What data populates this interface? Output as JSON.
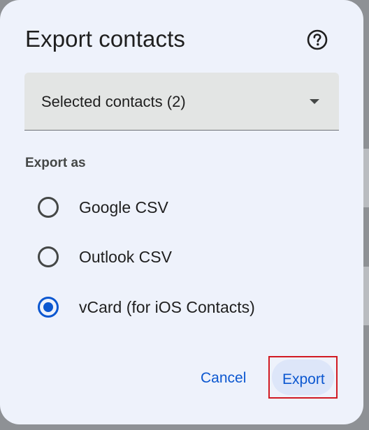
{
  "dialog": {
    "title": "Export contacts",
    "help_icon": "help-circle-icon"
  },
  "selector": {
    "value": "Selected contacts (2)",
    "caret_icon": "dropdown-caret-icon"
  },
  "export_as": {
    "label": "Export as",
    "options": [
      {
        "label": "Google CSV",
        "selected": false
      },
      {
        "label": "Outlook CSV",
        "selected": false
      },
      {
        "label": "vCard (for iOS Contacts)",
        "selected": true
      }
    ]
  },
  "actions": {
    "cancel_label": "Cancel",
    "export_label": "Export"
  },
  "colors": {
    "accent": "#0b57d0",
    "highlight_border": "#d11a22",
    "dialog_bg": "#eef2fb"
  }
}
